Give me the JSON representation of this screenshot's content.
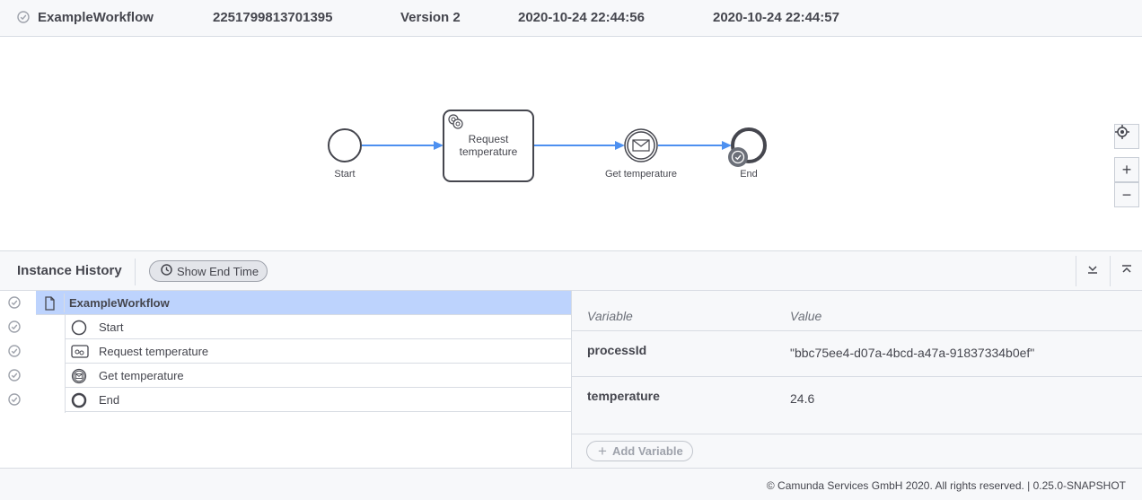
{
  "header": {
    "workflow_name": "ExampleWorkflow",
    "instance_id": "2251799813701395",
    "version": "Version 2",
    "start_date": "2020-10-24 22:44:56",
    "end_date": "2020-10-24 22:44:57"
  },
  "diagram": {
    "start_label": "Start",
    "task_label_line1": "Request",
    "task_label_line2": "temperature",
    "message_label": "Get temperature",
    "end_label": "End",
    "flow_color": "#4d90f0"
  },
  "zoom": {
    "reset_icon": "crosshair-icon",
    "zoom_in": "+",
    "zoom_out": "−"
  },
  "history": {
    "title": "Instance History",
    "show_end_time": "Show End Time",
    "tree": [
      {
        "label": "ExampleWorkflow",
        "icon": "document-icon",
        "selected": true
      },
      {
        "label": "Start",
        "icon": "start-event-icon"
      },
      {
        "label": "Request temperature",
        "icon": "task-icon"
      },
      {
        "label": "Get temperature",
        "icon": "message-event-icon"
      },
      {
        "label": "End",
        "icon": "end-event-icon"
      }
    ]
  },
  "variables": {
    "col_variable": "Variable",
    "col_value": "Value",
    "rows": [
      {
        "name": "processId",
        "value": "\"bbc75ee4-d07a-4bcd-a47a-91837334b0ef\""
      },
      {
        "name": "temperature",
        "value": "24.6"
      }
    ],
    "add_button": "Add Variable"
  },
  "footer": {
    "copyright": "© Camunda Services GmbH 2020. All rights reserved. | 0.25.0-SNAPSHOT"
  },
  "colors": {
    "selected_row": "#bdd3fd",
    "panel_bg": "#f7f8fa",
    "border": "#d8dce3",
    "text": "#45464e"
  }
}
